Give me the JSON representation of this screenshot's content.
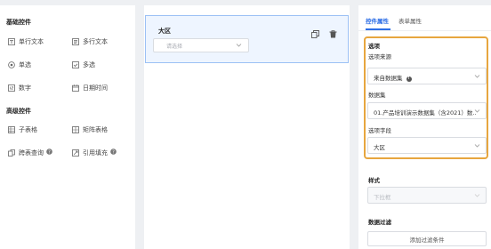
{
  "left_panel": {
    "basic_title": "基础控件",
    "advanced_title": "高级控件",
    "basic_controls": [
      {
        "label": "单行文本"
      },
      {
        "label": "多行文本"
      },
      {
        "label": "单选"
      },
      {
        "label": "多选"
      },
      {
        "label": "数字"
      },
      {
        "label": "日期时间"
      }
    ],
    "advanced_controls": [
      {
        "label": "子表格"
      },
      {
        "label": "矩阵表格"
      },
      {
        "label": "跨表查询"
      },
      {
        "label": "引用填充"
      }
    ]
  },
  "canvas": {
    "field_label": "大区",
    "select_placeholder": "请选择"
  },
  "right_panel": {
    "tabs": [
      {
        "label": "控件属性",
        "active": true
      },
      {
        "label": "表单属性",
        "active": false
      }
    ],
    "options_section": "选项",
    "source_label": "选项来源",
    "source_value": "来自数据集",
    "dataset_label": "数据集",
    "dataset_value": "01.产品培训演示数据集（含2021）数...",
    "field_label": "选项字段",
    "field_value": "大区",
    "style_section": "样式",
    "style_value": "下拉框",
    "filter_section": "数据过滤",
    "filter_button": "添加过滤条件"
  },
  "colors": {
    "accent": "#2d6ee6",
    "highlight": "#e7a63f",
    "selected_field_bg": "#eef5ff"
  }
}
